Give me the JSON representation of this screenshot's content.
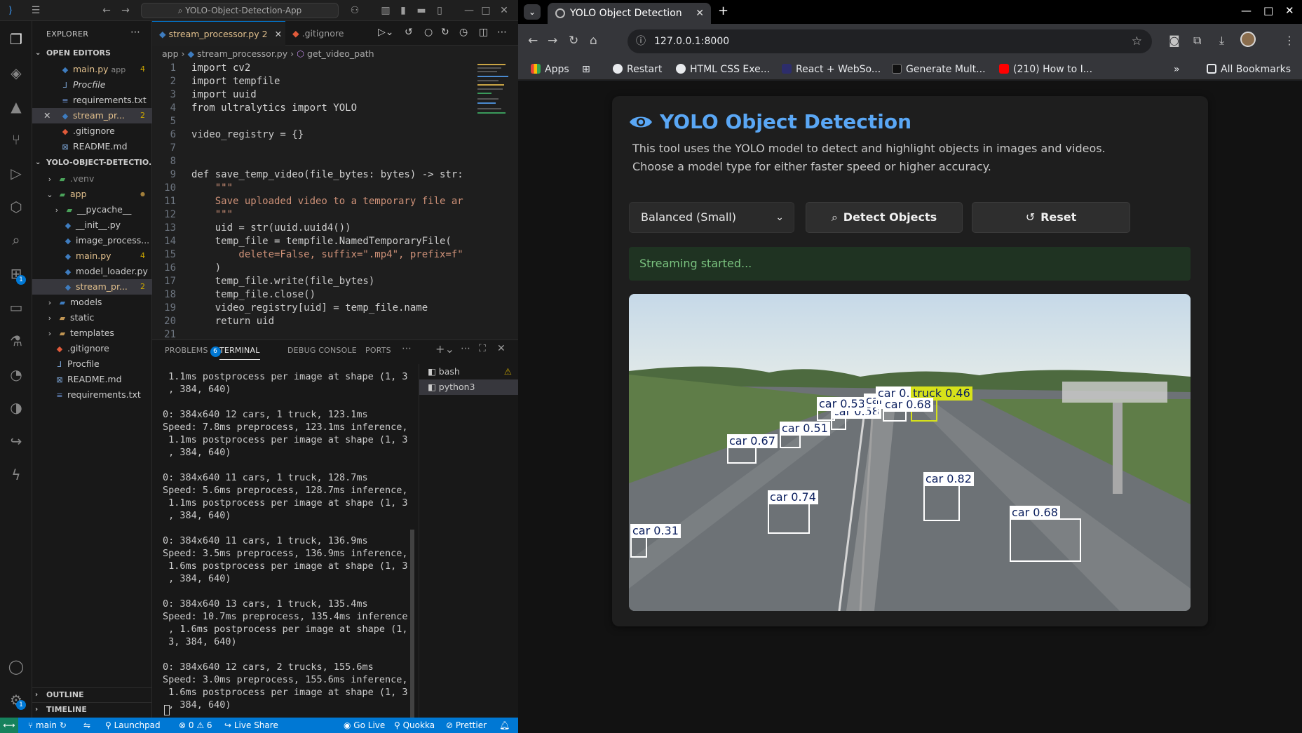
{
  "vscode": {
    "search": "YOLO-Object-Detection-App",
    "sidebar": {
      "title": "EXPLORER",
      "open_editors_title": "OPEN EDITORS",
      "open_editors": [
        {
          "name": "main.py",
          "hint": "app",
          "badge": "4"
        },
        {
          "name": "Procfile",
          "hint": "",
          "badge": ""
        },
        {
          "name": "requirements.txt",
          "hint": "",
          "badge": ""
        },
        {
          "name": "stream_pr...",
          "hint": "",
          "badge": "2"
        },
        {
          "name": ".gitignore",
          "hint": "",
          "badge": ""
        },
        {
          "name": "README.md",
          "hint": "",
          "badge": ""
        }
      ],
      "project_title": "YOLO-OBJECT-DETECTIO...",
      "tree": [
        {
          "name": ".venv",
          "badge": ""
        },
        {
          "name": "app",
          "badge": "●"
        },
        {
          "name": "__pycache__",
          "badge": ""
        },
        {
          "name": "__init__.py",
          "badge": ""
        },
        {
          "name": "image_process...",
          "badge": ""
        },
        {
          "name": "main.py",
          "badge": "4"
        },
        {
          "name": "model_loader.py",
          "badge": ""
        },
        {
          "name": "stream_pr...",
          "badge": "2"
        },
        {
          "name": "models",
          "badge": ""
        },
        {
          "name": "static",
          "badge": ""
        },
        {
          "name": "templates",
          "badge": ""
        },
        {
          "name": ".gitignore",
          "badge": ""
        },
        {
          "name": "Procfile",
          "badge": ""
        },
        {
          "name": "README.md",
          "badge": ""
        },
        {
          "name": "requirements.txt",
          "badge": ""
        }
      ],
      "outline": "OUTLINE",
      "timeline": "TIMELINE"
    },
    "tabs": [
      {
        "label": "stream_processor.py",
        "badge": "2"
      },
      {
        "label": ".gitignore",
        "badge": ""
      }
    ],
    "breadcrumb": [
      "app",
      "stream_processor.py",
      "get_video_path"
    ],
    "code": [
      {
        "n": "1",
        "t": "import cv2"
      },
      {
        "n": "2",
        "t": "import tempfile"
      },
      {
        "n": "3",
        "t": "import uuid"
      },
      {
        "n": "4",
        "t": "from ultralytics import YOLO"
      },
      {
        "n": "5",
        "t": ""
      },
      {
        "n": "6",
        "t": "video_registry = {}"
      },
      {
        "n": "7",
        "t": ""
      },
      {
        "n": "8",
        "t": ""
      },
      {
        "n": "9",
        "t": "def save_temp_video(file_bytes: bytes) -> str:"
      },
      {
        "n": "10",
        "t": "    \"\"\""
      },
      {
        "n": "11",
        "t": "    Save uploaded video to a temporary file ar"
      },
      {
        "n": "12",
        "t": "    \"\"\""
      },
      {
        "n": "13",
        "t": "    uid = str(uuid.uuid4())"
      },
      {
        "n": "14",
        "t": "    temp_file = tempfile.NamedTemporaryFile("
      },
      {
        "n": "15",
        "t": "        delete=False, suffix=\".mp4\", prefix=f\""
      },
      {
        "n": "16",
        "t": "    )"
      },
      {
        "n": "17",
        "t": "    temp_file.write(file_bytes)"
      },
      {
        "n": "18",
        "t": "    temp_file.close()"
      },
      {
        "n": "19",
        "t": "    video_registry[uid] = temp_file.name"
      },
      {
        "n": "20",
        "t": "    return uid"
      },
      {
        "n": "21",
        "t": ""
      }
    ],
    "panel": {
      "tabs": [
        "PROBLEMS",
        "TERMINAL",
        "DEBUG CONSOLE",
        "PORTS"
      ],
      "problems_count": "6",
      "terminal_lines": [
        " 1.1ms postprocess per image at shape (1, 3",
        " , 384, 640)",
        "",
        "0: 384x640 12 cars, 1 truck, 123.1ms",
        "Speed: 7.8ms preprocess, 123.1ms inference,",
        " 1.1ms postprocess per image at shape (1, 3",
        " , 384, 640)",
        "",
        "0: 384x640 11 cars, 1 truck, 128.7ms",
        "Speed: 5.6ms preprocess, 128.7ms inference,",
        " 1.1ms postprocess per image at shape (1, 3",
        " , 384, 640)",
        "",
        "0: 384x640 11 cars, 1 truck, 136.9ms",
        "Speed: 3.5ms preprocess, 136.9ms inference,",
        " 1.6ms postprocess per image at shape (1, 3",
        " , 384, 640)",
        "",
        "0: 384x640 13 cars, 1 truck, 135.4ms",
        "Speed: 10.7ms preprocess, 135.4ms inference",
        " , 1.6ms postprocess per image at shape (1,",
        " 3, 384, 640)",
        "",
        "0: 384x640 12 cars, 2 trucks, 155.6ms",
        "Speed: 3.0ms preprocess, 155.6ms inference,",
        " 1.6ms postprocess per image at shape (1, 3",
        " , 384, 640)"
      ],
      "terminals": [
        "bash",
        "python3"
      ]
    },
    "status": {
      "branch": "main",
      "launchpad": "Launchpad",
      "errors": "0",
      "warnings": "6",
      "liveshare": "Live Share",
      "golive": "Go Live",
      "quokka": "Quokka",
      "prettier": "Prettier"
    }
  },
  "browser": {
    "tab_title": "YOLO Object Detection",
    "url": "127.0.0.1:8000",
    "bookmarks": [
      "Apps",
      "Restart",
      "HTML CSS Exe...",
      "React + WebSo...",
      "Generate Mult...",
      "(210) How to I...",
      "All Bookmarks"
    ],
    "app": {
      "title": "YOLO Object Detection",
      "description": "This tool uses the YOLO model to detect and highlight objects in images and videos. Choose a model type for either faster speed or higher accuracy.",
      "model_select": "Balanced (Small)",
      "detect_button": "Detect Objects",
      "reset_button": "Reset",
      "status": "Streaming started...",
      "detections": [
        {
          "label": "car 0.31",
          "cls": "car"
        },
        {
          "label": "car 0.74",
          "cls": "car"
        },
        {
          "label": "car 0.67",
          "cls": "car"
        },
        {
          "label": "car 0.51",
          "cls": "car"
        },
        {
          "label": "car 0.58",
          "cls": "car"
        },
        {
          "label": "car 0.53",
          "cls": "car"
        },
        {
          "label": "car 0.45",
          "cls": "car"
        },
        {
          "label": "car 0.",
          "cls": "car"
        },
        {
          "label": "truck 0.46",
          "cls": "truck"
        },
        {
          "label": "car 0.68",
          "cls": "car"
        },
        {
          "label": "car 0.82",
          "cls": "car"
        },
        {
          "label": "car 0.68",
          "cls": "car"
        }
      ]
    }
  }
}
